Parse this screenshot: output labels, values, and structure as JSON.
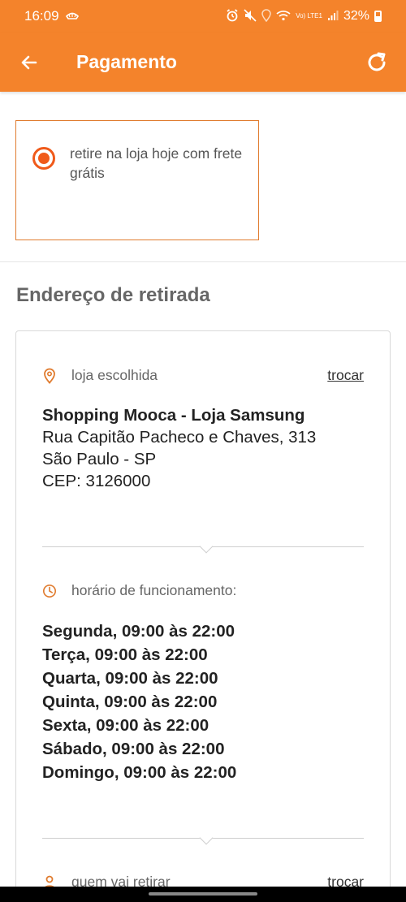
{
  "status_bar": {
    "time": "16:09",
    "battery": "32%",
    "network": "Vo) LTE1"
  },
  "app_bar": {
    "title": "Pagamento"
  },
  "delivery_option": {
    "label": "retire na loja hoje com frete grátis",
    "selected": true
  },
  "pickup_address": {
    "section_title": "Endereço de retirada",
    "store_label": "loja escolhida",
    "change_link": "trocar",
    "store_name": "Shopping Mooca - Loja Samsung",
    "street": "Rua Capitão Pacheco e Chaves, 313",
    "city": "São Paulo - SP",
    "zip": "CEP: 3126000",
    "hours_label": "horário de funcionamento:",
    "hours": [
      "Segunda, 09:00 às 22:00",
      "Terça, 09:00 às 22:00",
      "Quarta, 09:00 às 22:00",
      "Quinta, 09:00 às 22:00",
      "Sexta, 09:00 às 22:00",
      "Sábado, 09:00 às 22:00",
      "Domingo, 09:00 às 22:00"
    ],
    "pickup_person_label": "quem vai retirar",
    "pickup_person_link": "trocar"
  },
  "colors": {
    "brand": "#f4832b",
    "radio": "#f05a1a"
  }
}
